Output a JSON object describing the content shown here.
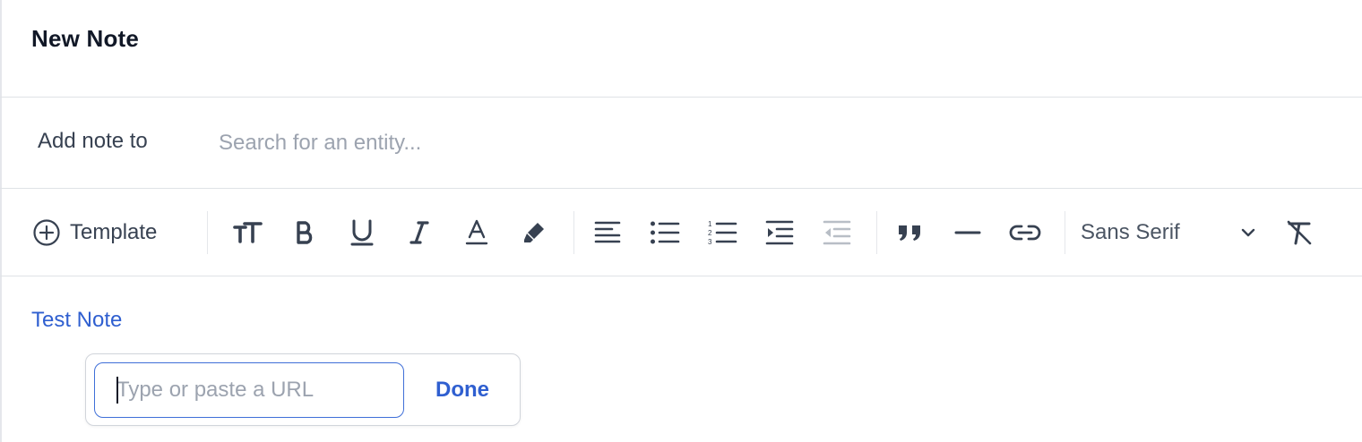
{
  "header": {
    "title": "New Note"
  },
  "target": {
    "label": "Add note to",
    "placeholder": "Search for an entity..."
  },
  "toolbar": {
    "template_label": "Template",
    "font_family_value": "Sans Serif",
    "buttons": [
      {
        "name": "text-size",
        "icon": "text-size-icon"
      },
      {
        "name": "bold",
        "icon": "bold-icon"
      },
      {
        "name": "underline",
        "icon": "underline-icon"
      },
      {
        "name": "italic",
        "icon": "italic-icon"
      },
      {
        "name": "text-color",
        "icon": "text-color-icon"
      },
      {
        "name": "highlight",
        "icon": "highlighter-icon"
      },
      {
        "name": "align-left",
        "icon": "align-left-icon"
      },
      {
        "name": "bullet-list",
        "icon": "bullet-list-icon"
      },
      {
        "name": "numbered-list",
        "icon": "numbered-list-icon"
      },
      {
        "name": "indent",
        "icon": "indent-icon"
      },
      {
        "name": "outdent",
        "icon": "outdent-icon",
        "disabled": true
      },
      {
        "name": "blockquote",
        "icon": "quote-icon"
      },
      {
        "name": "horizontal-rule",
        "icon": "horizontal-rule-icon"
      },
      {
        "name": "link",
        "icon": "link-icon"
      },
      {
        "name": "clear-format",
        "icon": "clear-format-icon"
      }
    ]
  },
  "editor": {
    "content_link_text": "Test Note"
  },
  "link_popover": {
    "placeholder": "Type or paste a URL",
    "value": "",
    "done_label": "Done"
  },
  "colors": {
    "accent": "#2f5fd0",
    "icon": "#374151",
    "disabled_icon": "#b8bec6",
    "border": "#dfe2e6"
  }
}
